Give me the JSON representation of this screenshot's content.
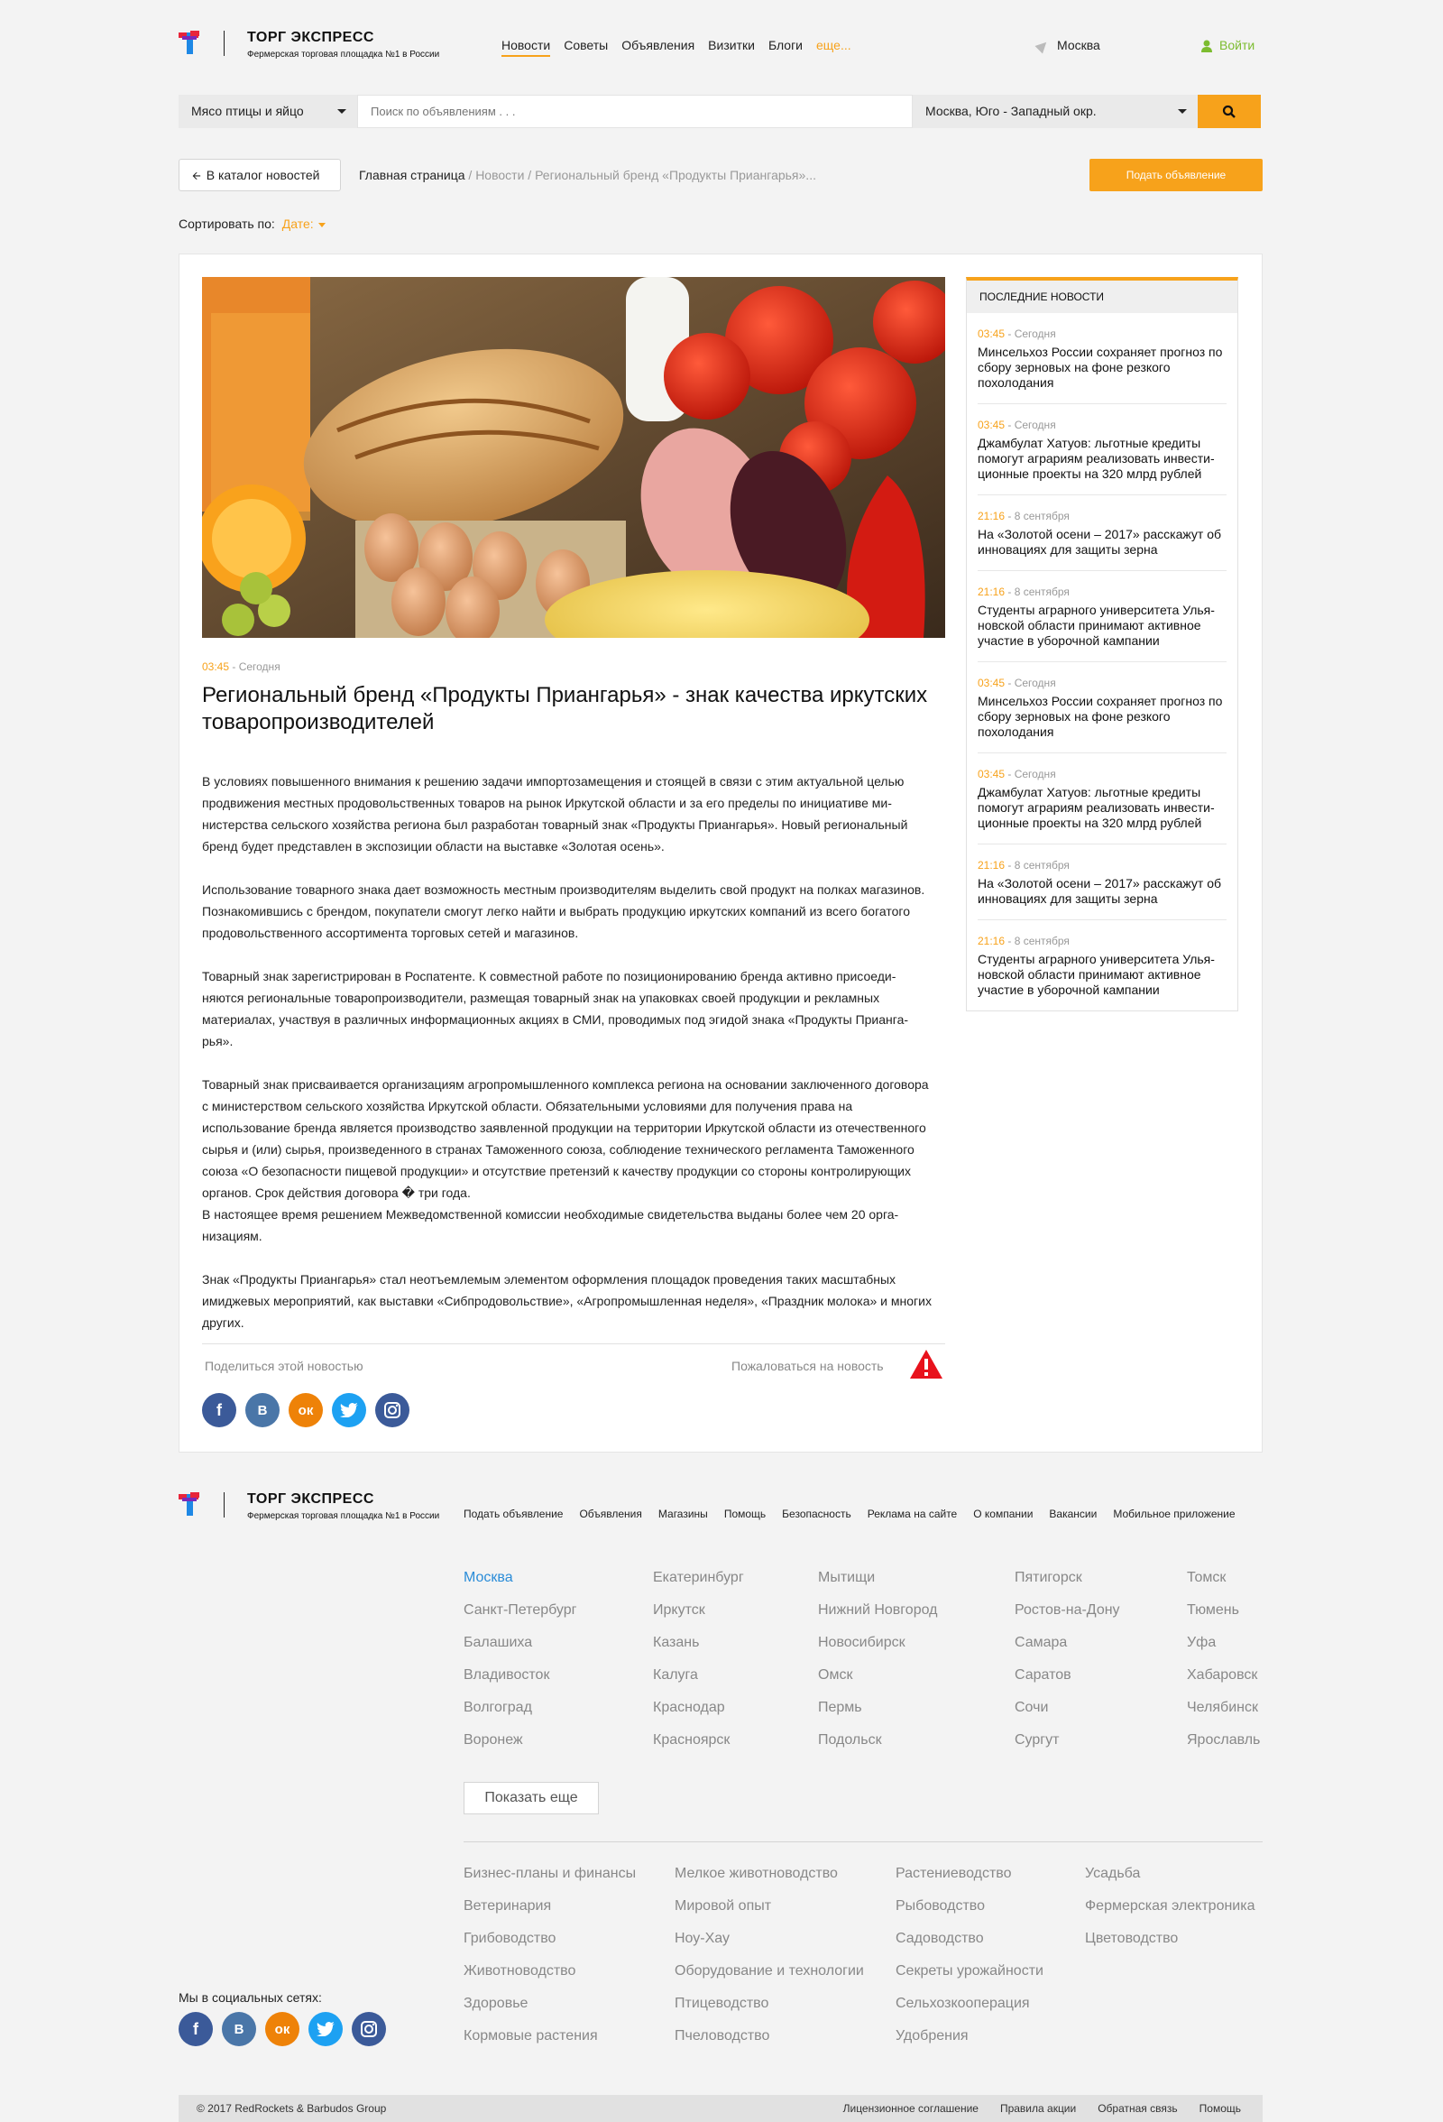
{
  "header": {
    "brand": "ТОРГ ЭКСПРЕСС",
    "tagline": "Фермерская торговая площадка №1 в России",
    "nav": [
      "Новости",
      "Советы",
      "Объявления",
      "Визитки",
      "Блоги",
      "еще..."
    ],
    "city": "Москва",
    "login": "Войти"
  },
  "search": {
    "category": "Мясо птицы и яйцо",
    "placeholder": "Поиск по объявлениям . . .",
    "region": "Москва, Юго - Западный окр."
  },
  "breadcrumb_row": {
    "back_label": "В каталог новостей",
    "home": "Главная страница",
    "rest": " / Новости / Региональный бренд «Продукты Приангарья»...",
    "post_button": "Подать объявление"
  },
  "sort": {
    "label": "Сортировать по:",
    "value": "Дате:"
  },
  "article": {
    "time": "03:45",
    "date": " - Сегодня",
    "title": "Региональный бренд «Продукты Приангарья» - знак качества иркут­ских товаропроизводителей",
    "paragraphs": [
      "В условиях повышенного внимания к решению задачи импортозамещения и стоящей в связи с этим актуальной целью продвижения местных продовольственных товаров на рынок Иркутской области и за его пределы по инициативе ми­нистерства сельского хозяйства региона был разработан товарный знак «Продукты Приангарья». Новый региональ­ный бренд будет представлен в экспозиции области на выставке «Золотая осень».",
      "Использование товарного знака дает возможность местным производителям выделить свой продукт на полках мага­зинов. Познакомившись с брендом, покупатели смогут легко найти и выбрать продукцию иркутских компаний из всего богатого продовольственного ассортимента торговых сетей и магазинов.",
      "Товарный знак зарегистрирован в Роспатенте. К совместной работе по позиционированию бренда активно присоеди­няются региональные товаропроизводители, размещая товарный знак на упаковках своей продукции и рекламных материалах, участвуя в различных информационных акциях в СМИ, проводимых под эгидой знака «Продукты Прианга­рья».",
      "Товарный знак присваивается организациям агропромышленного комплекса региона на основании заключенного договора с министерством сельского хозяйства Иркутской области. Обязательными условиями для получения права на использование бренда является производство заявленной продукции на территории Иркутской области из отече­ственного сырья и (или) сырья, произведенного в странах Таможенного союза, соблюдение технического регламента Таможенного союза «О безопасности пищевой продукции» и отсутствие претензий к качеству продукции со стороны контролирующих органов. Срок действия договора � три года.",
      "В настоящее время решением Межведомственной комиссии необходимые свидетельства выданы более чем 20 орга­низациям.",
      "Знак «Продукты Приангарья» стал неотъемлемым элементом оформления площадок проведения таких масштабных имиджевых мероприятий, как выставки «Сибпродовольствие», «Агропромышленная неделя», «Праздник молока» и многих других."
    ],
    "share_label": "Поделиться этой новостью",
    "complain_label": "Пожаловаться на новость"
  },
  "sidebar": {
    "title": "Последние новости",
    "items": [
      {
        "time": "03:45",
        "date": " - Сегодня",
        "title": "Минсельхоз России сохраняет прогноз по сбору зерновых на фоне резкого похолодания"
      },
      {
        "time": "03:45",
        "date": " - Сегодня",
        "title": "Джамбулат Хатуов: льготные кредиты помогут аграриям реализовать инвести­ционные проекты на 320 млрд рублей"
      },
      {
        "time": "21:16",
        "date": " - 8 сентября",
        "title": "На «Золотой осени – 2017» расскажут об инновациях для защиты зерна"
      },
      {
        "time": "21:16",
        "date": " - 8 сентября",
        "title": "Студенты аграрного университета Улья­новской области принимают активное участие в уборочной кампании"
      },
      {
        "time": "03:45",
        "date": " - Сегодня",
        "title": "Минсельхоз России сохраняет прогноз по сбору зерновых на фоне резкого похолодания"
      },
      {
        "time": "03:45",
        "date": " - Сегодня",
        "title": "Джамбулат Хатуов: льготные кредиты помогут аграриям реализовать инвести­ционные проекты на 320 млрд рублей"
      },
      {
        "time": "21:16",
        "date": " - 8 сентября",
        "title": "На «Золотой осени – 2017» расскажут об инновациях для защиты зерна"
      },
      {
        "time": "21:16",
        "date": " - 8 сентября",
        "title": "Студенты аграрного университета Улья­новской области принимают активное участие в уборочной кампании"
      }
    ]
  },
  "footer": {
    "brand": "ТОРГ ЭКСПРЕСС",
    "tagline": "Фермерская торговая площадка №1 в России",
    "nav": [
      "Подать объявление",
      "Объявления",
      "Магазины",
      "Помощь",
      "Безопасность",
      "Реклама на сайте",
      "О компании",
      "Вакансии",
      "Мобильное приложение"
    ],
    "city_columns": [
      [
        "Москва",
        "Санкт-Петербург",
        "Балашиха",
        "Владивосток",
        "Волгоград",
        "Воронеж"
      ],
      [
        "Екатеринбург",
        "Иркутск",
        "Казань",
        "Калуга",
        "Краснодар",
        "Красноярск"
      ],
      [
        "Мытищи",
        "Нижний Новгород",
        "Новосибирск",
        "Омск",
        "Пермь",
        "Подольск"
      ],
      [
        "Пятигорск",
        "Ростов-на-Дону",
        "Самара",
        "Саратов",
        "Сочи",
        "Сургут"
      ],
      [
        "Томск",
        "Тюмень",
        "Уфа",
        "Хабаровск",
        "Челябинск",
        "Ярославль"
      ]
    ],
    "show_more": "Показать еще",
    "category_columns": [
      [
        "Бизнес-планы и финансы",
        "Ветеринария",
        "Грибоводство",
        "Животноводство",
        "Здоровье",
        "Кормовые растения"
      ],
      [
        "Мелкое животноводство",
        "Мировой опыт",
        "Ноу-Хау",
        "Оборудование и технологии",
        "Птицеводство",
        "Пчеловодство"
      ],
      [
        "Растениеводство",
        "Рыбоводство",
        "Садоводство",
        "Секреты урожайности",
        "Сельхозкооперация",
        "Удобрения"
      ],
      [
        "Усадьба",
        "Фермерская электроника",
        "Цветоводство"
      ]
    ],
    "social_title": "Мы в социальных сетях:",
    "copyright": "© 2017 RedRockets & Barbudos Group",
    "bottom_links": [
      "Лицензионное соглашение",
      "Правила акции",
      "Обратная связь",
      "Помощь"
    ]
  },
  "colors": {
    "accent": "#f7a21b",
    "link_blue": "#2a8cd8",
    "login_green": "#7cbc2f"
  },
  "icons": [
    "logo-icon",
    "location-pin-icon",
    "user-icon",
    "search-icon",
    "arrow-left-icon",
    "warning-icon",
    "facebook-icon",
    "vk-icon",
    "odnoklassniki-icon",
    "twitter-icon",
    "instagram-icon"
  ]
}
